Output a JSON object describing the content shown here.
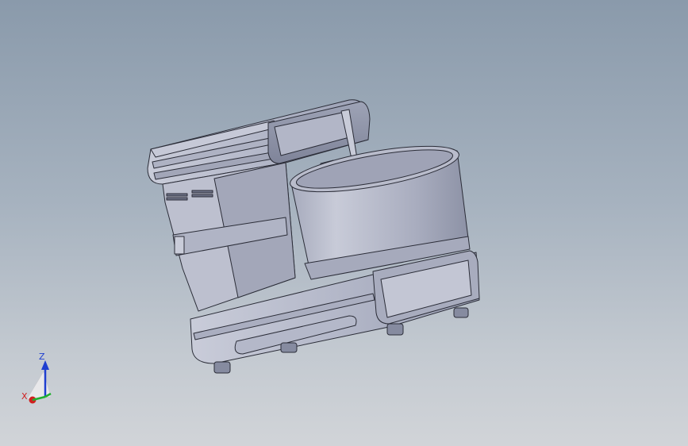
{
  "viewport": {
    "background_top": "#8a9aab",
    "background_bottom": "#d1d4d8",
    "model_color": "#b8bccc",
    "model_shade": "#8f94a8",
    "edge_color": "#2b2d38"
  },
  "triad": {
    "z_label": "Z",
    "x_label": "X",
    "z_color": "#1f3fd0",
    "x_color": "#d02020",
    "y_color": "#20b030"
  }
}
